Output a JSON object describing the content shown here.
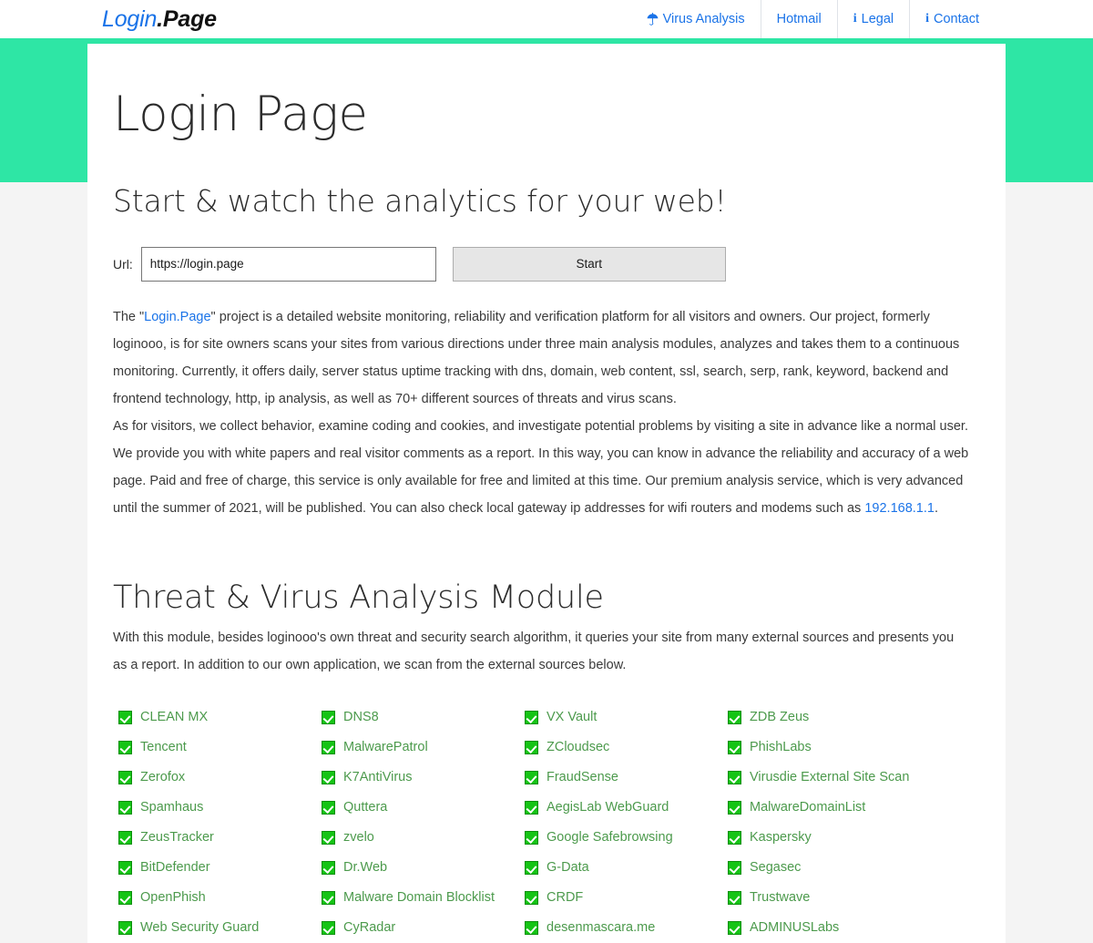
{
  "header": {
    "logo_primary": "Login",
    "logo_secondary": ".Page",
    "nav": [
      {
        "label": "Virus Analysis",
        "icon": "umbrella-icon"
      },
      {
        "label": "Hotmail",
        "icon": "none"
      },
      {
        "label": "Legal",
        "icon": "info-icon"
      },
      {
        "label": "Contact",
        "icon": "info-icon"
      }
    ]
  },
  "hero": {
    "title": "Login Page",
    "subtitle": "Start & watch the analytics for your web!"
  },
  "form": {
    "url_label": "Url:",
    "url_value": "https://login.page",
    "url_placeholder": "https://login.page",
    "start_label": "Start"
  },
  "intro": {
    "p1_a": "The \"",
    "p1_link": "Login.Page",
    "p1_b": "\" project is a detailed website monitoring, reliability and verification platform for all visitors and owners. Our project, formerly loginooo, is for site owners scans your sites from various directions under three main analysis modules, analyzes and takes them to a continuous monitoring. Currently, it offers daily, server status uptime tracking with dns, domain, web content, ssl, search, serp, rank, keyword, backend and frontend technology, http, ip analysis, as well as 70+ different sources of threats and virus scans.",
    "p2_a": "As for visitors, we collect behavior, examine coding and cookies, and investigate potential problems by visiting a site in advance like a normal user. We provide you with white papers and real visitor comments as a report. In this way, you can know in advance the reliability and accuracy of a web page. Paid and free of charge, this service is only available for free and limited at this time. Our premium analysis service, which is very advanced until the summer of 2021, will be published. You can also check local gateway ip addresses for wifi routers and modems such as ",
    "p2_link": "192.168.1.1",
    "p2_b": "."
  },
  "module": {
    "title": "Threat & Virus Analysis Module",
    "description": "With this module, besides loginooo's own threat and security search algorithm, it queries your site from many external sources and presents you as a report. In addition to our own application, we scan from the external sources below."
  },
  "sources": [
    "CLEAN MX",
    "DNS8",
    "VX Vault",
    "ZDB Zeus",
    "Tencent",
    "MalwarePatrol",
    "ZCloudsec",
    "PhishLabs",
    "Zerofox",
    "K7AntiVirus",
    "FraudSense",
    "Virusdie External Site Scan",
    "Spamhaus",
    "Quttera",
    "AegisLab WebGuard",
    "MalwareDomainList",
    "ZeusTracker",
    "zvelo",
    "Google Safebrowsing",
    "Kaspersky",
    "BitDefender",
    "Dr.Web",
    "G-Data",
    "Segasec",
    "OpenPhish",
    "Malware Domain Blocklist",
    "CRDF",
    "Trustwave",
    "Web Security Guard",
    "CyRadar",
    "desenmascara.me",
    "ADMINUSLabs"
  ],
  "colors": {
    "brand_blue": "#1a73e8",
    "band_green": "#2ee6a5",
    "check_green": "#15c415",
    "source_label": "#4c9a4c",
    "page_bg": "#f4f4f4"
  }
}
